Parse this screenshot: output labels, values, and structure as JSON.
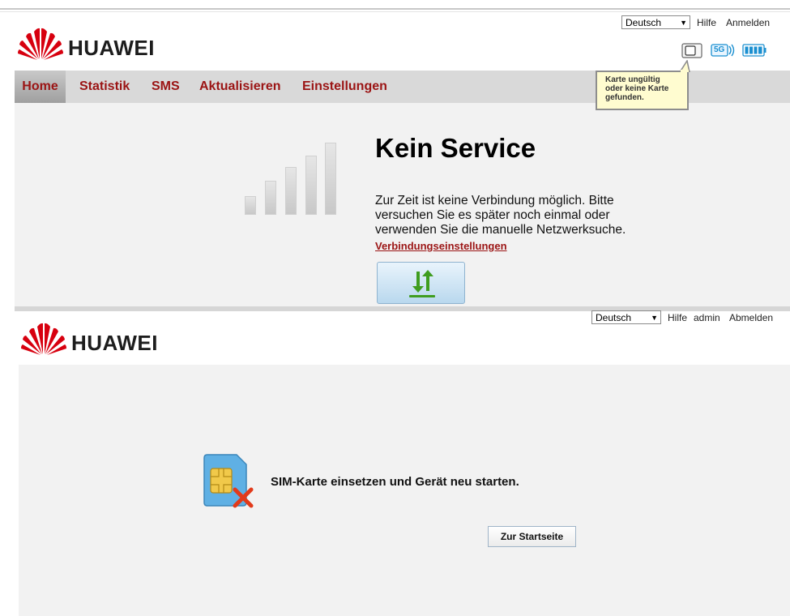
{
  "top_panel": {
    "language": "Deutsch",
    "links": {
      "help": "Hilfe",
      "login": "Anmelden"
    },
    "logo_text": "HUAWEI",
    "status_icons": [
      "sim-card-icon",
      "5g-signal-icon",
      "battery-icon"
    ],
    "network_badge": "5G",
    "tooltip": "Karte ungültig oder keine Karte gefunden.",
    "nav": {
      "home": "Home",
      "statistics": "Statistik",
      "sms": "SMS",
      "update": "Aktualisieren",
      "settings": "Einstellungen"
    },
    "status": {
      "title": "Kein Service",
      "message": "Zur Zeit ist keine Verbindung möglich. Bitte versuchen Sie es später noch einmal oder verwenden Sie die manuelle Netzwerksuche.",
      "link": "Verbindungseinstellungen"
    },
    "signal_bars_active": 0
  },
  "bottom_panel": {
    "language": "Deutsch",
    "links": {
      "help": "Hilfe",
      "user": "admin",
      "logout": "Abmelden"
    },
    "logo_text": "HUAWEI",
    "message": "SIM-Karte einsetzen und Gerät neu starten.",
    "button": "Zur Startseite"
  },
  "colors": {
    "brand_red": "#9b1414",
    "huawei_logo_red": "#d7000f",
    "panel_bg": "#f2f2f2"
  }
}
